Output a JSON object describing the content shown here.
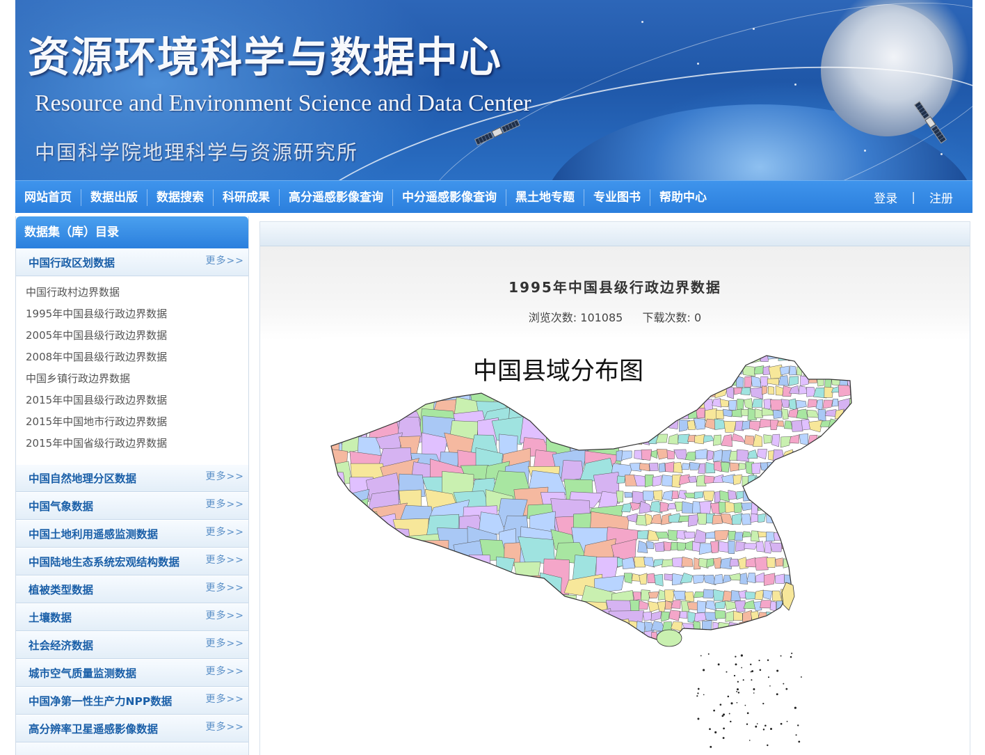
{
  "banner": {
    "title_cn": "资源环境科学与数据中心",
    "title_en": "Resource and Environment Science and Data Center",
    "org": "中国科学院地理科学与资源研究所"
  },
  "nav": {
    "items": [
      "网站首页",
      "数据出版",
      "数据搜索",
      "科研成果",
      "高分遥感影像查询",
      "中分遥感影像查询",
      "黑土地专题",
      "专业图书",
      "帮助中心"
    ],
    "login": "登录",
    "separator": "|",
    "register": "注册"
  },
  "sidebar": {
    "heading": "数据集（库）目录",
    "more_label": "更多>>",
    "expanded_category": "中国行政区划数据",
    "sub_items": [
      "中国行政村边界数据",
      "1995年中国县级行政边界数据",
      "2005年中国县级行政边界数据",
      "2008年中国县级行政边界数据",
      "中国乡镇行政边界数据",
      "2015年中国县级行政边界数据",
      "2015年中国地市行政边界数据",
      "2015年中国省级行政边界数据"
    ],
    "categories": [
      "中国自然地理分区数据",
      "中国气象数据",
      "中国土地利用遥感监测数据",
      "中国陆地生态系统宏观结构数据",
      "植被类型数据",
      "土壤数据",
      "社会经济数据",
      "城市空气质量监测数据",
      "中国净第一性生产力NPP数据",
      "高分辨率卫星遥感影像数据"
    ]
  },
  "main": {
    "dataset_title": "1995年中国县级行政边界数据",
    "views_label": "浏览次数:",
    "views_value": "101085",
    "downloads_label": "下载次数:",
    "downloads_value": "0",
    "map_title": "中国县域分布图"
  },
  "colors": {
    "nav_blue": "#2b7fdd",
    "link_blue": "#1a5fa8",
    "county_fills": [
      "#f4a6c9",
      "#a8e6a1",
      "#a9c8f5",
      "#f7e79a",
      "#d6b3f2",
      "#9fe3e0",
      "#f5b9a0",
      "#c9f0b0",
      "#e0c0ff",
      "#b8d4ff"
    ]
  }
}
